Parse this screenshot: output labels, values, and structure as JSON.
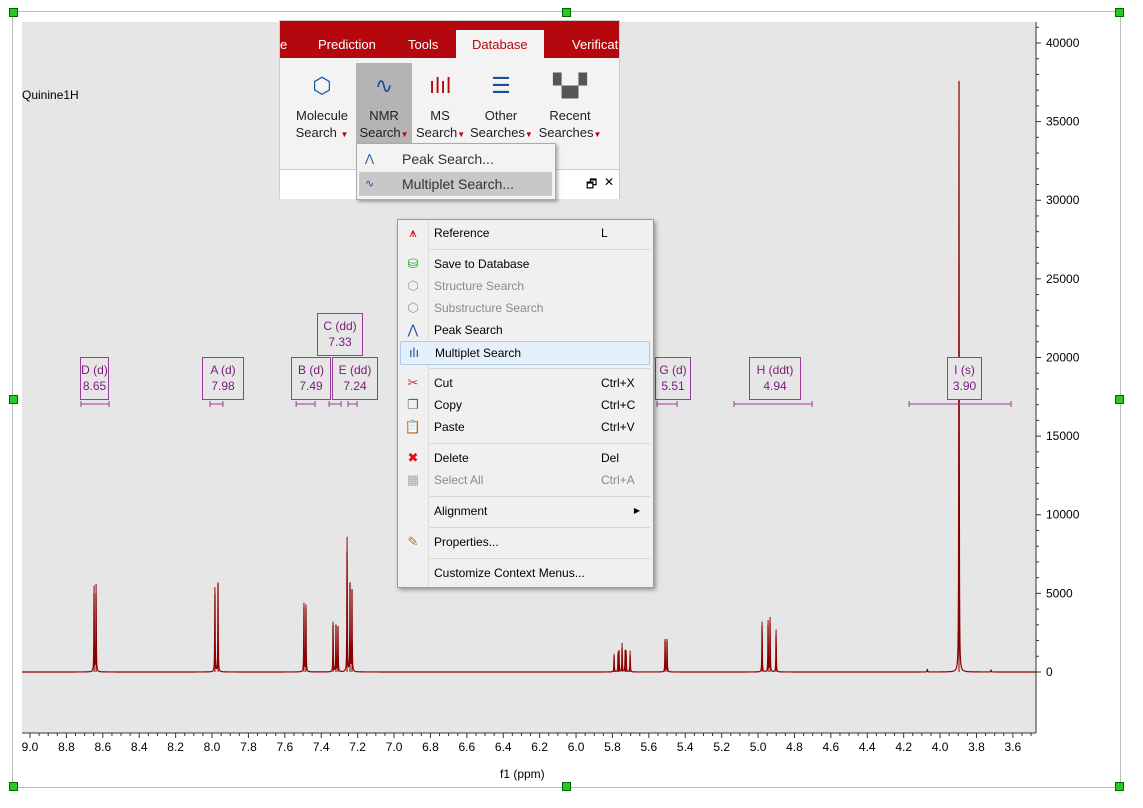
{
  "spectrum_title": "Quinine1H",
  "colors": {
    "spectrum": "#8b0000",
    "label": "#9a3a9a",
    "ribbon": "#b5080e",
    "plot_bg": "#e6e6e6"
  },
  "chart_data": {
    "type": "line",
    "xlabel": "f1 (ppm)",
    "xlim": [
      9.044,
      3.473
    ],
    "ylim": [
      -3880,
      41335
    ],
    "x_reversed": true,
    "x_ticks": [
      "9.0",
      "8.8",
      "8.6",
      "8.4",
      "8.2",
      "8.0",
      "7.8",
      "7.6",
      "7.4",
      "7.2",
      "7.0",
      "6.8",
      "6.6",
      "6.4",
      "6.2",
      "6.0",
      "5.8",
      "5.6",
      "5.4",
      "5.2",
      "5.0",
      "4.8",
      "4.6",
      "4.4",
      "4.2",
      "4.0",
      "3.8",
      "3.6"
    ],
    "y_ticks": [
      "0",
      "5000",
      "10000",
      "15000",
      "20000",
      "25000",
      "30000",
      "35000",
      "40000"
    ],
    "y_axis_side": "right",
    "peaks": [
      [
        8.648,
        5500
      ],
      [
        8.637,
        5600
      ],
      [
        7.984,
        5400
      ],
      [
        7.967,
        5700
      ],
      [
        7.495,
        4400
      ],
      [
        7.484,
        4300
      ],
      [
        7.335,
        3200
      ],
      [
        7.319,
        3000
      ],
      [
        7.308,
        2900
      ],
      [
        7.258,
        8600
      ],
      [
        7.242,
        5600
      ],
      [
        7.231,
        5200
      ],
      [
        5.791,
        1150
      ],
      [
        5.769,
        1300
      ],
      [
        5.764,
        1300
      ],
      [
        5.747,
        1850
      ],
      [
        5.73,
        1400
      ],
      [
        5.725,
        1400
      ],
      [
        5.703,
        1350
      ],
      [
        5.511,
        2100
      ],
      [
        5.5,
        2100
      ],
      [
        4.978,
        3200
      ],
      [
        4.945,
        3300
      ],
      [
        4.934,
        3500
      ],
      [
        4.901,
        2700
      ],
      [
        4.07,
        200
      ],
      [
        3.896,
        37600
      ],
      [
        3.72,
        150
      ]
    ],
    "multiplets": [
      {
        "name": "D (d)",
        "shift": "8.65",
        "range": [
          8.72,
          8.566
        ]
      },
      {
        "name": "A (d)",
        "shift": "7.98",
        "range": [
          8.011,
          7.94
        ]
      },
      {
        "name": "B (d)",
        "shift": "7.49",
        "range": [
          7.538,
          7.434
        ]
      },
      {
        "name": "C (dd)",
        "shift": "7.33",
        "range": [
          7.357,
          7.291
        ]
      },
      {
        "name": "E (dd)",
        "shift": "7.24",
        "range": [
          7.253,
          7.203
        ]
      },
      {
        "name": "G (d)",
        "shift": "5.51",
        "range": [
          5.555,
          5.445
        ]
      },
      {
        "name": "H (ddt)",
        "shift": "4.94",
        "range": [
          5.132,
          4.703
        ]
      },
      {
        "name": "I (s)",
        "shift": "3.90",
        "range": [
          4.17,
          3.61
        ]
      }
    ]
  },
  "ribbon": {
    "tabs": [
      "e",
      "Prediction",
      "Tools",
      "Database",
      "Verification"
    ],
    "active_tab": "Database",
    "buttons": [
      {
        "line1": "Molecule",
        "line2": "Search",
        "icon": "molecule-binoculars-icon"
      },
      {
        "line1": "NMR",
        "line2": "Search",
        "icon": "nmr-binoculars-icon"
      },
      {
        "line1": "MS",
        "line2": "Search",
        "icon": "ms-binoculars-icon"
      },
      {
        "line1": "Other",
        "line2": "Searches",
        "icon": "list-binoculars-icon"
      },
      {
        "line1": "Recent",
        "line2": "Searches",
        "icon": "binoculars-icon"
      }
    ],
    "nmr_dropdown": [
      "Peak Search...",
      "Multiplet Search..."
    ],
    "pane_restore": "🗗",
    "pane_close": "✕"
  },
  "context_menu": {
    "items": [
      {
        "label": "Reference",
        "shortcut": "L",
        "icon": "tms-icon"
      },
      {
        "label": "Save to Database",
        "shortcut": "",
        "icon": "database-save-icon"
      },
      {
        "label": "Structure Search",
        "shortcut": "",
        "icon": "structure-search-icon",
        "disabled": true
      },
      {
        "label": "Substructure Search",
        "shortcut": "",
        "icon": "substructure-search-icon",
        "disabled": true
      },
      {
        "label": "Peak Search",
        "shortcut": "",
        "icon": "peak-search-icon"
      },
      {
        "label": "Multiplet Search",
        "shortcut": "",
        "icon": "multiplet-search-icon",
        "highlighted": true
      },
      {
        "label": "Cut",
        "shortcut": "Ctrl+X",
        "icon": "scissors-icon"
      },
      {
        "label": "Copy",
        "shortcut": "Ctrl+C",
        "icon": "copy-icon"
      },
      {
        "label": "Paste",
        "shortcut": "Ctrl+V",
        "icon": "paste-icon"
      },
      {
        "label": "Delete",
        "shortcut": "Del",
        "icon": "delete-icon"
      },
      {
        "label": "Select All",
        "shortcut": "Ctrl+A",
        "icon": "select-all-icon",
        "disabled": true
      },
      {
        "label": "Alignment",
        "shortcut": "",
        "icon": "",
        "submenu": true
      },
      {
        "label": "Properties...",
        "shortcut": "",
        "icon": "properties-icon"
      },
      {
        "label": "Customize Context Menus...",
        "shortcut": "",
        "icon": ""
      }
    ]
  }
}
